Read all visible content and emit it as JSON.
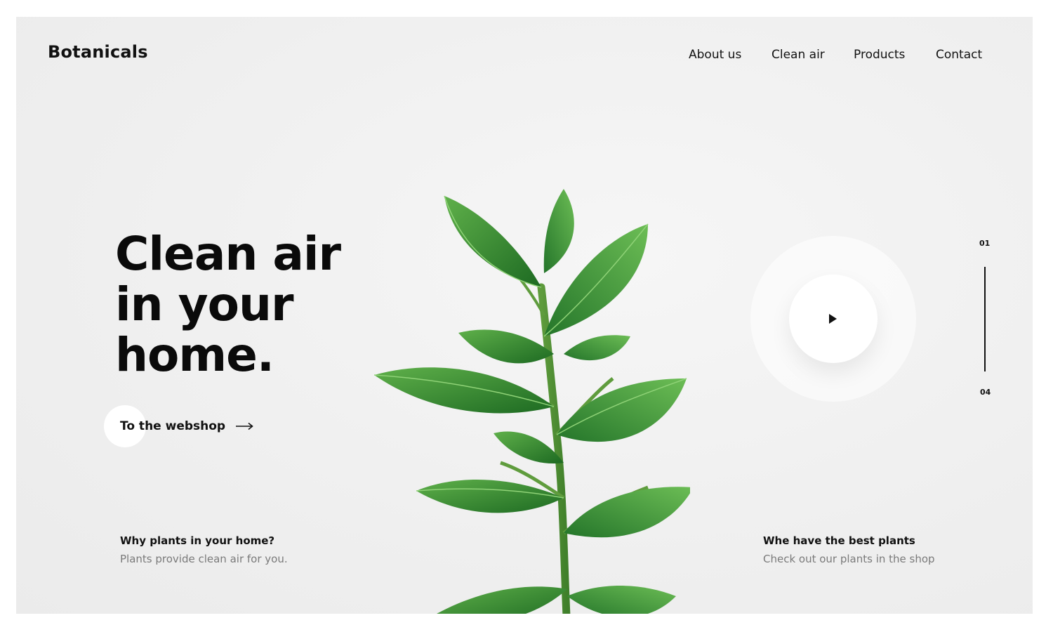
{
  "header": {
    "brand": "Botanicals",
    "nav": [
      "About us",
      "Clean air",
      "Products",
      "Contact"
    ]
  },
  "hero": {
    "headline_lines": [
      "Clean air",
      "in your",
      "home."
    ],
    "cta_label": "To the webshop",
    "cta_icon": "arrow-right-icon",
    "play_icon": "play-icon",
    "plant_image": "rubber-plant-illustration"
  },
  "slider": {
    "start": "01",
    "end": "04"
  },
  "features": [
    {
      "title": "Why plants in your home?",
      "description": "Plants provide clean air for you."
    },
    {
      "title": "Whe have the best plants",
      "description": "Check out our plants in the shop"
    }
  ],
  "colors": {
    "background": "#efefef",
    "text": "#111111",
    "muted": "#7a7a7a",
    "leaf": "#3c9a37",
    "leaf_dark": "#1f6b23"
  }
}
